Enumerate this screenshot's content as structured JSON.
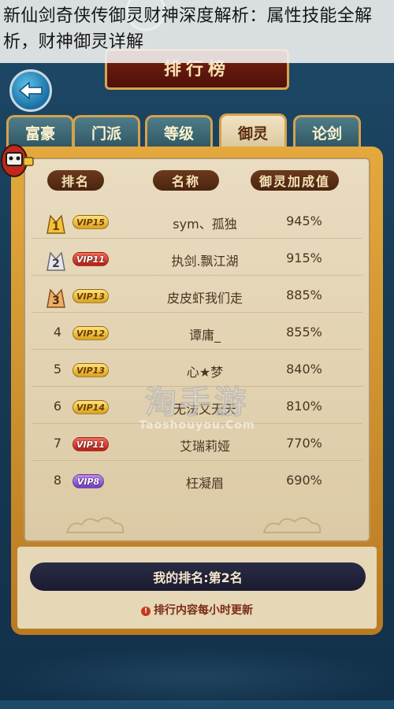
{
  "headline": "新仙剑奇侠传御灵财神深度解析：属性技能全解析，财神御灵详解",
  "title": "排行榜",
  "tabs": [
    {
      "label": "富豪",
      "active": false
    },
    {
      "label": "门派",
      "active": false
    },
    {
      "label": "等级",
      "active": false
    },
    {
      "label": "御灵",
      "active": true
    },
    {
      "label": "论剑",
      "active": false
    }
  ],
  "columns": {
    "rank": "排名",
    "name": "名称",
    "value": "御灵加成值"
  },
  "rows": [
    {
      "rank": "1",
      "vip": "VIP15",
      "vip_color": "gold",
      "name": "sym、孤独",
      "value": "945%"
    },
    {
      "rank": "2",
      "vip": "VIP11",
      "vip_color": "red",
      "name": "执剑.飘江湖",
      "value": "915%"
    },
    {
      "rank": "3",
      "vip": "VIP13",
      "vip_color": "gold",
      "name": "皮皮虾我们走",
      "value": "885%"
    },
    {
      "rank": "4",
      "vip": "VIP12",
      "vip_color": "gold",
      "name": "谭庸_",
      "value": "855%"
    },
    {
      "rank": "5",
      "vip": "VIP13",
      "vip_color": "gold",
      "name": "心★梦",
      "value": "840%"
    },
    {
      "rank": "6",
      "vip": "VIP14",
      "vip_color": "gold",
      "name": "无法又无天",
      "value": "810%"
    },
    {
      "rank": "7",
      "vip": "VIP11",
      "vip_color": "red",
      "name": "艾瑞莉娅",
      "value": "770%"
    },
    {
      "rank": "8",
      "vip": "VIP8",
      "vip_color": "purple",
      "name": "枉凝眉",
      "value": "690%"
    }
  ],
  "my_rank": "我的排名:第2名",
  "update_note": "排行内容每小时更新",
  "watermark": {
    "main": "淘手游",
    "sub": "Taoshouyou.Com"
  }
}
